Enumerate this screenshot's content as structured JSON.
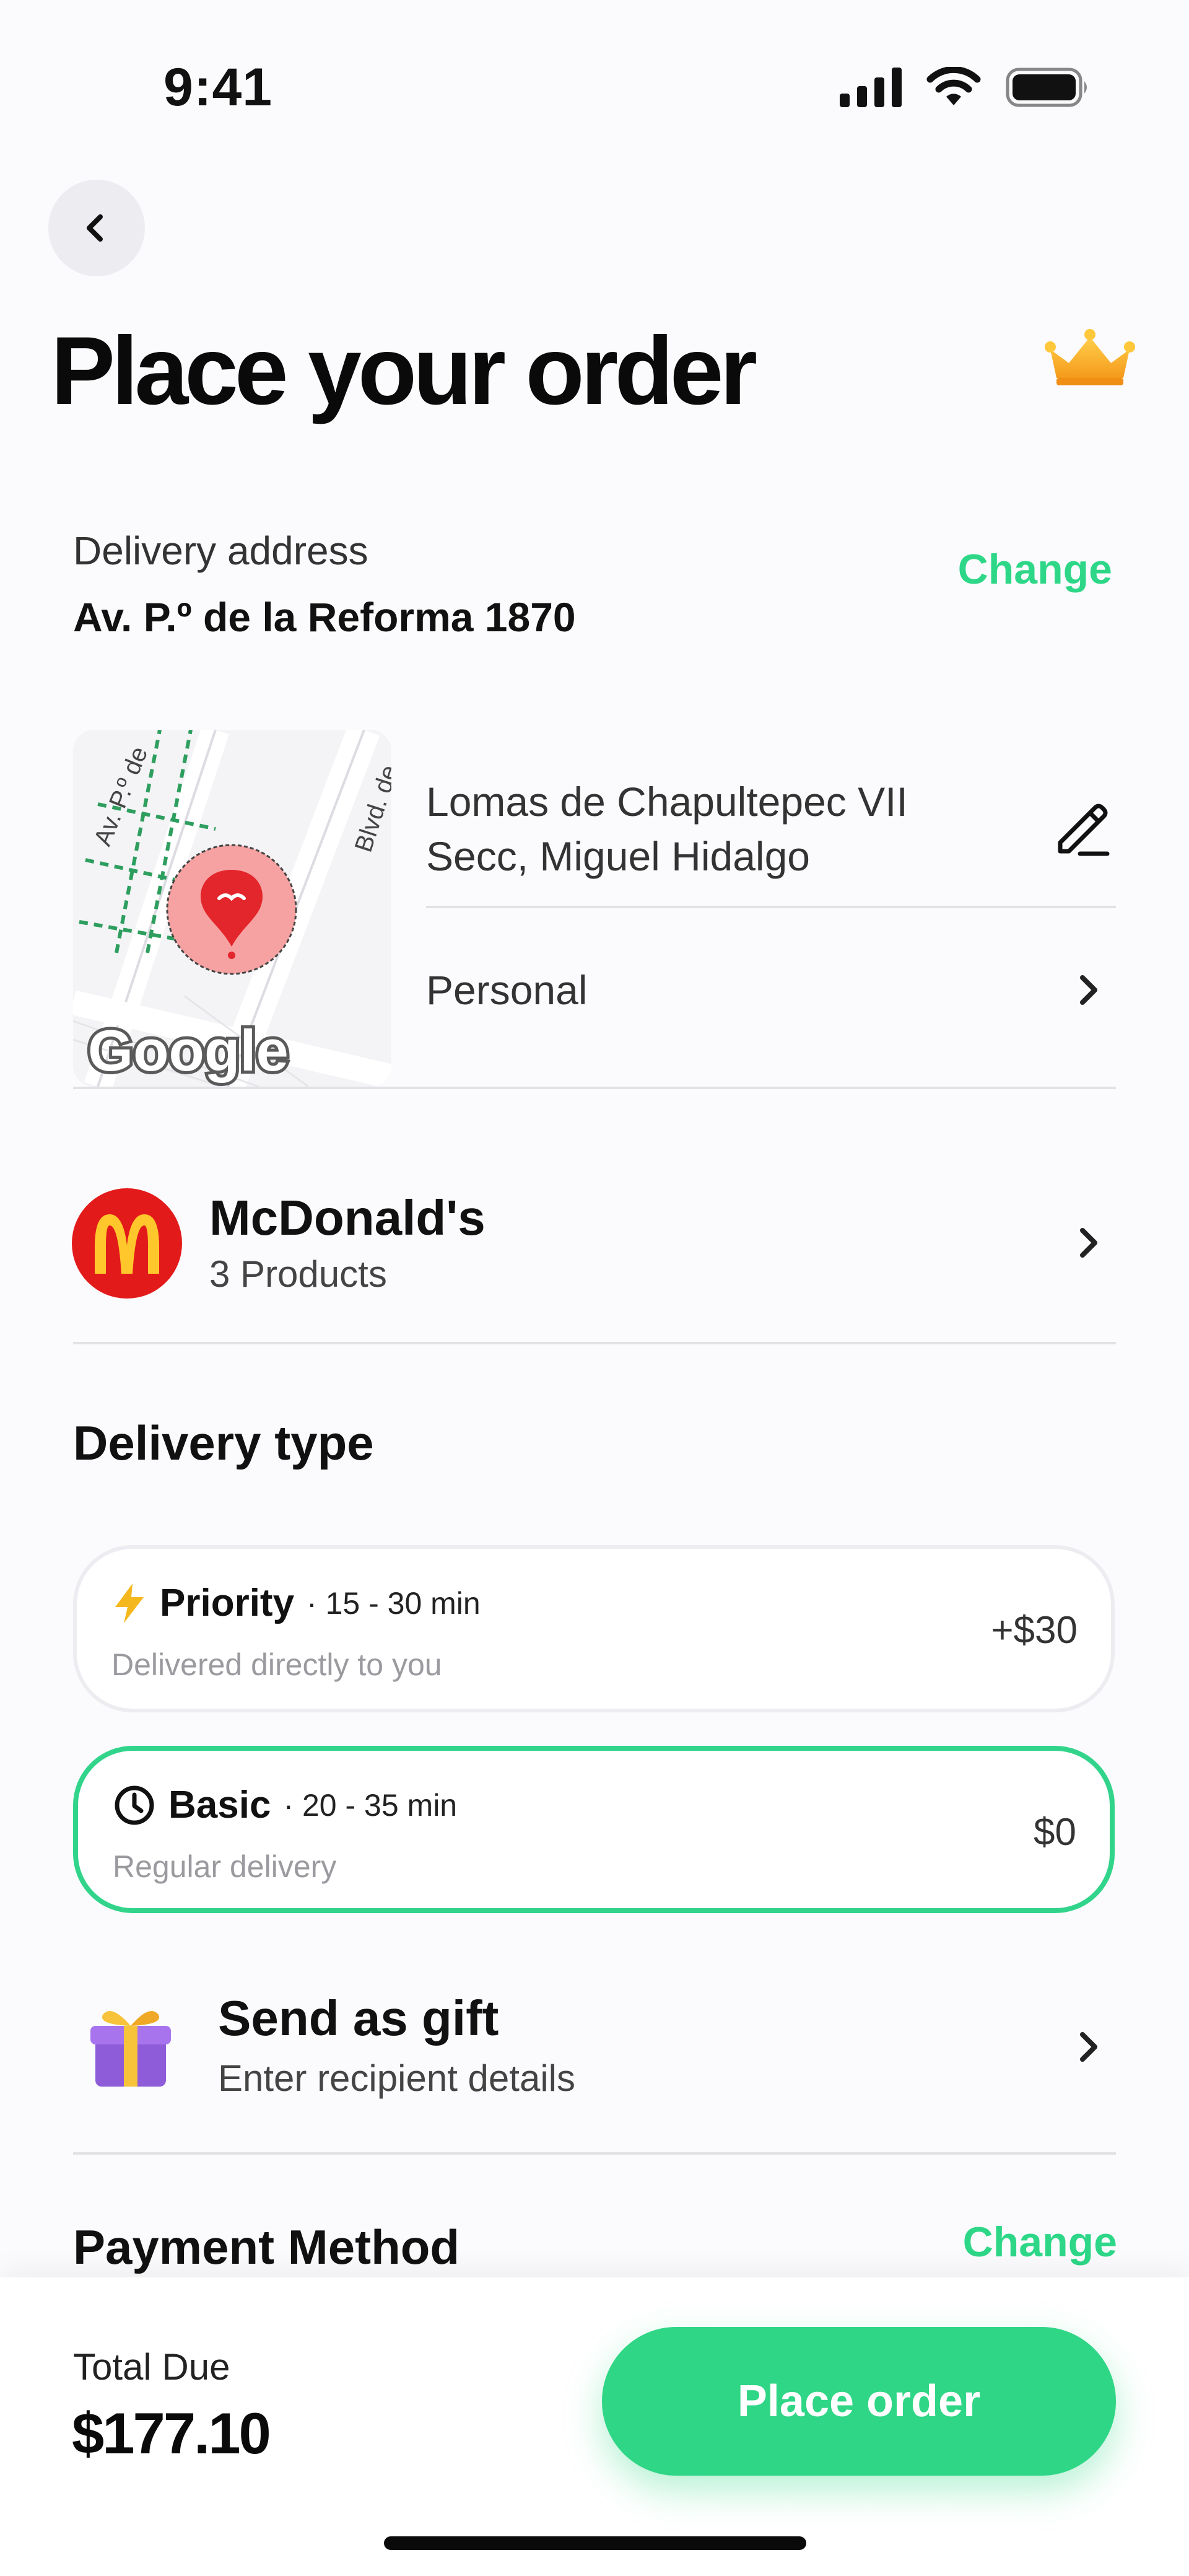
{
  "status_bar": {
    "time": "9:41",
    "icons": [
      "cellular-signal-icon",
      "wifi-icon",
      "battery-icon"
    ]
  },
  "header": {
    "back_icon": "chevron-left-icon",
    "title": "Place your order",
    "badge_icon": "crown-icon"
  },
  "delivery_address": {
    "label": "Delivery address",
    "value": "Av. P.º de la Reforma 1870",
    "change_label": "Change",
    "map": {
      "street_label_1": "Av. P.º de",
      "street_label_2": "Blvd. de",
      "provider_logo": "Google",
      "marker_icon": "location-pin-icon"
    },
    "detail": "Lomas de Chapultepec VII Secc, Miguel Hidalgo",
    "edit_icon": "pencil-icon",
    "tag": "Personal"
  },
  "store": {
    "name": "McDonald's",
    "products": "3 Products",
    "logo_icon": "mcdonalds-logo-icon"
  },
  "delivery_type": {
    "title": "Delivery type",
    "options": [
      {
        "name": "Priority",
        "time": "· 15 - 30 min",
        "subtitle": "Delivered directly to you",
        "price": "+$30",
        "icon": "lightning-icon",
        "selected": false
      },
      {
        "name": "Basic",
        "time": "· 20 - 35 min",
        "subtitle": "Regular delivery",
        "price": "$0",
        "icon": "clock-icon",
        "selected": true
      }
    ]
  },
  "gift": {
    "title": "Send as gift",
    "subtitle": "Enter recipient details",
    "icon": "gift-box-icon"
  },
  "payment": {
    "title": "Payment Method",
    "change_label": "Change"
  },
  "footer": {
    "total_label": "Total Due",
    "total_value": "$177.10",
    "cta_label": "Place order"
  },
  "colors": {
    "accent": "#2dd787",
    "brand_red": "#e31a1a",
    "brand_yellow": "#ffc72c",
    "text_primary": "#111111",
    "text_muted": "#9a9a9f"
  }
}
